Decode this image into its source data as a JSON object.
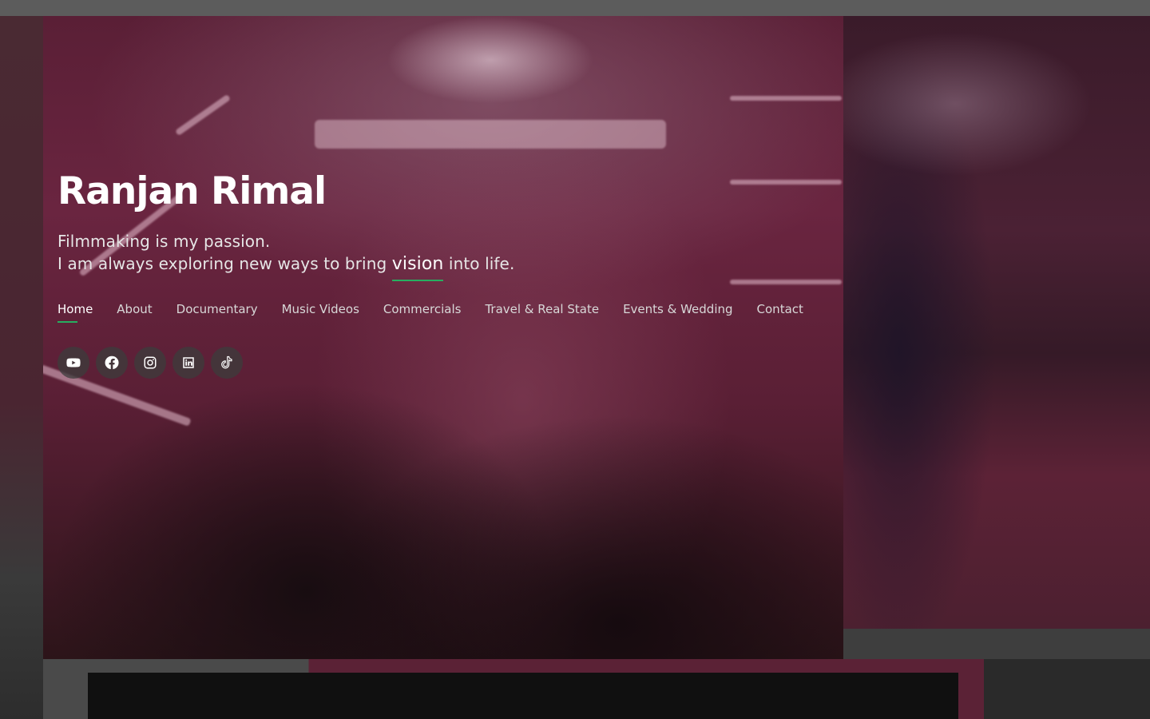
{
  "hero": {
    "title": "Ranjan Rimal",
    "tagline_line1": "Filmmaking is my passion.",
    "tagline_line2_before": "I am always exploring new ways to bring ",
    "tagline_line2_highlight": "vision",
    "tagline_line2_after": " into life."
  },
  "nav": {
    "items": [
      {
        "label": "Home",
        "active": true
      },
      {
        "label": "About"
      },
      {
        "label": "Documentary"
      },
      {
        "label": "Music Videos"
      },
      {
        "label": "Commercials"
      },
      {
        "label": "Travel & Real State"
      },
      {
        "label": "Events & Wedding"
      },
      {
        "label": "Contact"
      }
    ]
  },
  "social": [
    {
      "icon": "youtube-icon"
    },
    {
      "icon": "facebook-icon"
    },
    {
      "icon": "instagram-icon"
    },
    {
      "icon": "linkedin-icon"
    },
    {
      "icon": "tiktok-icon"
    }
  ],
  "colors": {
    "accent": "#27ae60",
    "text": "#ffffff",
    "nav_text": "#d8d8d8",
    "social_bg": "#3c3c3c"
  }
}
